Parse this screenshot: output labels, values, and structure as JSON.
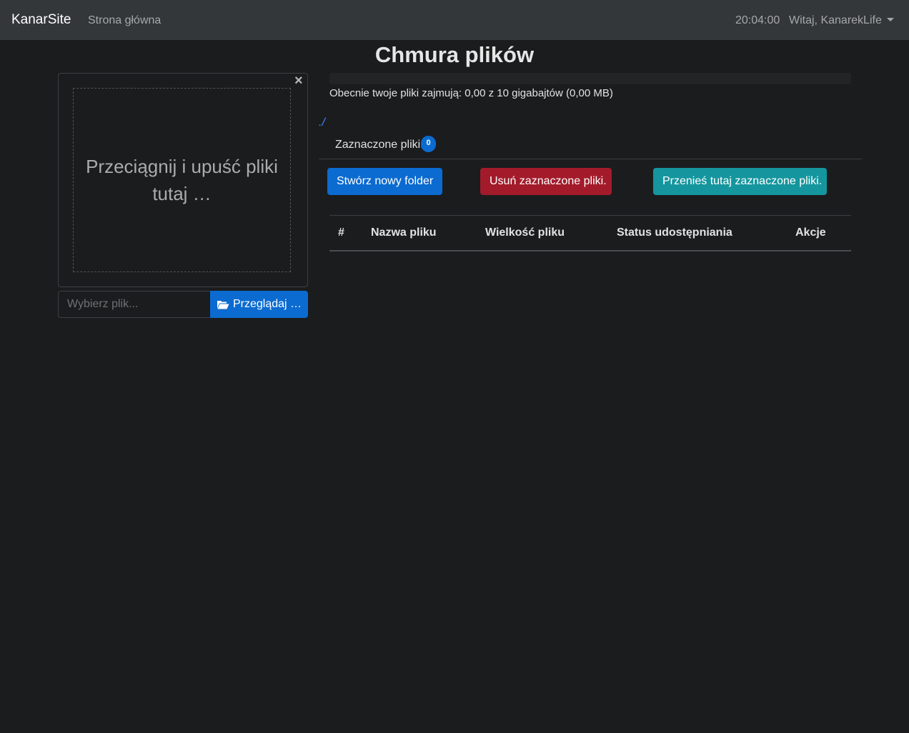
{
  "navbar": {
    "brand": "KanarSite",
    "home_link": "Strona główna",
    "clock": "20:04:00",
    "user_menu": "Witaj, KanarekLife"
  },
  "page": {
    "title": "Chmura plików"
  },
  "upload": {
    "drop_text": "Przeciągnij i upuść pliki tutaj …",
    "close_glyph": "×",
    "file_placeholder": "Wybierz plik...",
    "browse_label": "Przeglądaj …"
  },
  "storage": {
    "usage_text": "Obecnie twoje pliki zajmują: 0,00 z 10 gigabajtów (0,00 MB)",
    "used_fraction": 0
  },
  "browser": {
    "path": "./",
    "selected_label": "Zaznaczone pliki:",
    "selected_count": "0"
  },
  "actions": {
    "new_folder": "Stwórz nowy folder",
    "delete_selected": "Usuń zaznaczone pliki.",
    "move_here": "Przenieś tutaj zaznaczone pliki."
  },
  "table": {
    "headers": [
      "#",
      "Nazwa pliku",
      "Wielkość pliku",
      "Status udostępniania",
      "Akcje"
    ],
    "rows": []
  },
  "colors": {
    "primary": "#0b6bd0",
    "danger": "#a31b2b",
    "info": "#15969e",
    "navbar": "#33373a",
    "background": "#1b1c1e"
  },
  "icons": {
    "browse": "folder-open-icon",
    "dropdown": "caret-down-icon",
    "close": "close-icon"
  }
}
